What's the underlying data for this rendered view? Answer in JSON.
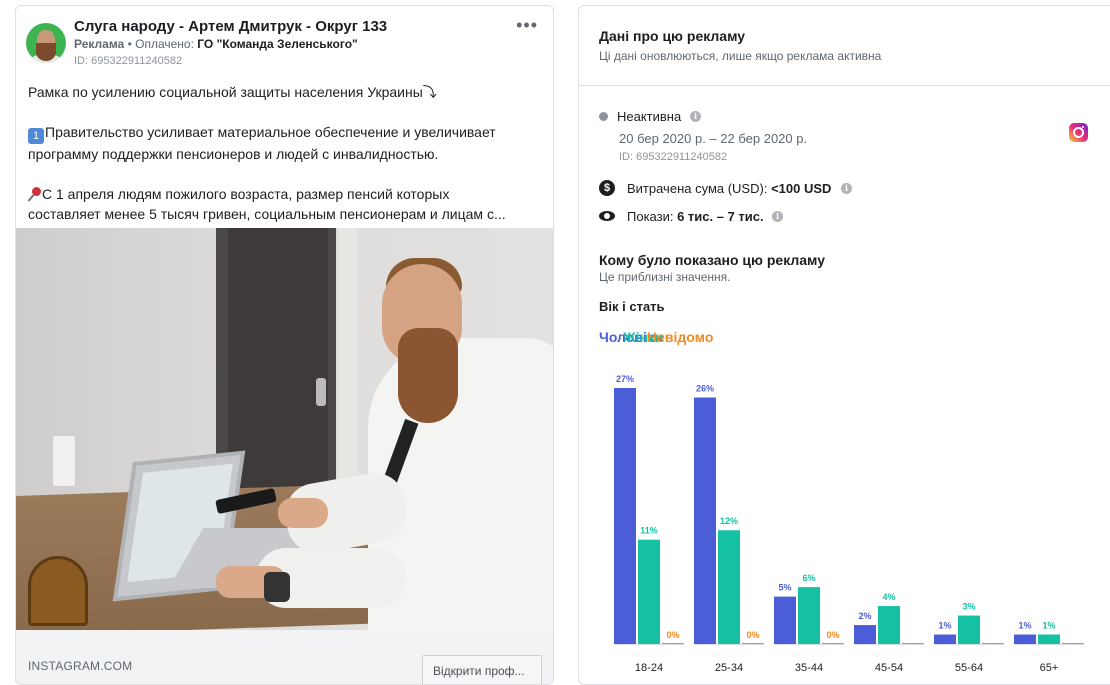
{
  "ad": {
    "page_name": "Слуга народу - Артем Дмитрук - Округ 133",
    "label": "Реклама",
    "paid_by_prefix": "Оплачено:",
    "paid_by": "ГО \"Команда Зеленського\"",
    "ad_id": "ID: 695322911240582",
    "more_icon": "more-dots-icon",
    "text_line1": "Рамка по усилению социальной защиты населения Украины⤵",
    "text_line2_badge": "1",
    "text_line2": "Правительство усиливает материальное обеспечение и увеличивает",
    "text_line3": "программу поддержки пенсионеров и людей с инвалидностью.",
    "text_line4": "С 1 апреля людям пожилого возраста, размер пенсий которых",
    "text_line5": "составляет менее 5 тысяч гривен, социальным пенсионерам и лицам с...",
    "footer_domain": "INSTAGRAM.COM",
    "footer_button": "Відкрити проф..."
  },
  "panel": {
    "title": "Дані про цю рекламу",
    "subtitle": "Ці дані оновлюються, лише якщо реклама активна",
    "status": "Неактивна",
    "dates": "20 бер 2020 р. – 22 бер 2020 р.",
    "ad_id": "ID: 695322911240582",
    "platform_icon": "instagram-icon",
    "spent_label": "Витрачена сума (USD):",
    "spent_value": "<100 USD",
    "views_label": "Покази:",
    "views_value": "6 тис. – 7 тис.",
    "who_title": "Кому було показано цю рекламу",
    "who_subtitle": "Це приблизні значення.",
    "age_gender_title": "Вік і стать"
  },
  "legend": {
    "men": "Чоловіки",
    "women": "Жінки",
    "unknown": "Невідомо"
  },
  "colors": {
    "men": "#4b5ed8",
    "women": "#14c2a3",
    "unknown": "#f28c1e"
  },
  "chart_data": {
    "type": "bar",
    "categories": [
      "18-24",
      "25-34",
      "35-44",
      "45-54",
      "55-64",
      "65+"
    ],
    "series": [
      {
        "name": "Чоловіки",
        "values": [
          27,
          26,
          5,
          2,
          1,
          1
        ],
        "labels": [
          "27%",
          "26%",
          "5%",
          "2%",
          "1%",
          "1%"
        ]
      },
      {
        "name": "Жінки",
        "values": [
          11,
          12,
          6,
          4,
          3,
          1
        ],
        "labels": [
          "11%",
          "12%",
          "6%",
          "4%",
          "3%",
          "1%"
        ]
      },
      {
        "name": "Невідомо",
        "values": [
          0,
          0,
          0,
          0,
          0,
          0
        ],
        "labels": [
          "0%",
          "0%",
          "0%",
          "",
          "",
          ""
        ]
      }
    ],
    "ylim": [
      0,
      27
    ],
    "legend_position": "top-left",
    "grid": false
  }
}
